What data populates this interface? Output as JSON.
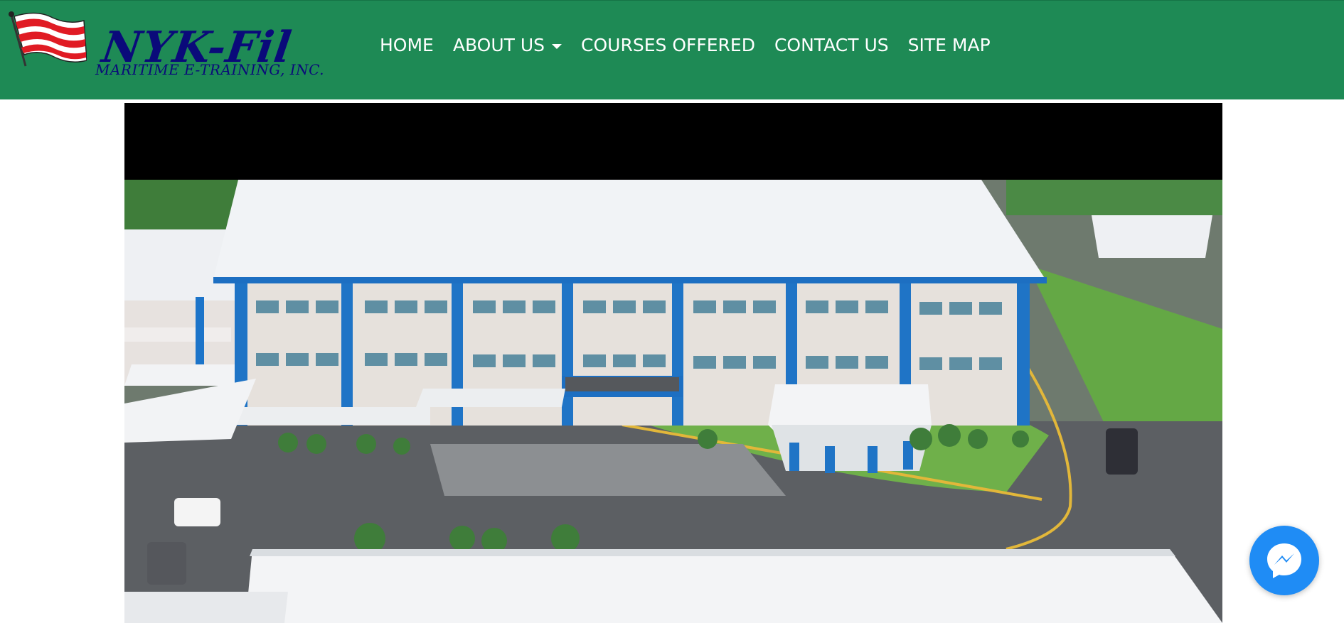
{
  "brand": {
    "name": "NYK-Fil",
    "tagline": "MARITIME E-TRAINING, INC."
  },
  "nav": {
    "home": "HOME",
    "about": "ABOUT US",
    "courses": "COURSES OFFERED",
    "contact": "CONTACT US",
    "sitemap": "SITE MAP"
  },
  "colors": {
    "navbar": "#1e8a55",
    "brand_navy": "#0a0a7a",
    "flag_red": "#e01b24",
    "messenger_blue": "#1f8cf5"
  },
  "icons": {
    "dropdown": "caret-down-icon",
    "messenger": "messenger-icon"
  }
}
